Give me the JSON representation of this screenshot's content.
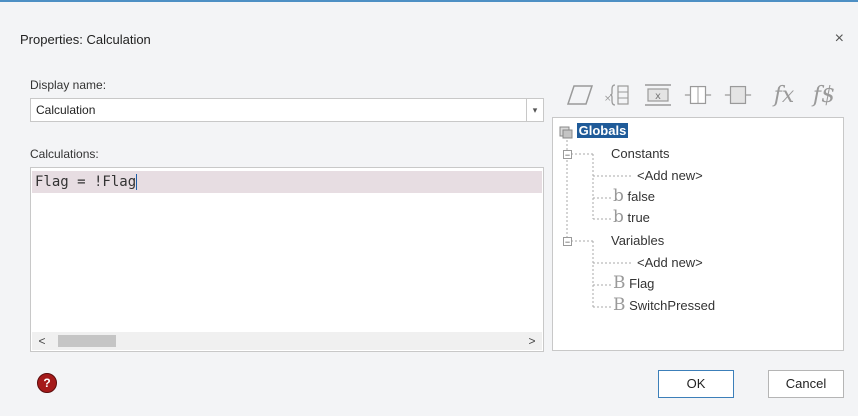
{
  "dialog": {
    "title": "Properties: Calculation",
    "close_glyph": "×"
  },
  "display_name": {
    "label": "Display name:",
    "value": "Calculation",
    "dropdown_glyph": "▾"
  },
  "calculations": {
    "label": "Calculations:",
    "code_line": "Flag = !Flag",
    "scroll_left_glyph": "<",
    "scroll_right_glyph": ">"
  },
  "toolbar": {
    "icons": [
      "parallelogram-icon",
      "x-brace-icon",
      "x-block-icon",
      "column-icon",
      "column-alt-icon",
      "fx-icon",
      "fs-icon"
    ],
    "fx_text": "fx",
    "fs_text": "f$"
  },
  "tree": {
    "root": "Globals",
    "constants": {
      "label": "Constants",
      "items": [
        "<Add new>",
        "false",
        "true"
      ]
    },
    "variables": {
      "label": "Variables",
      "items": [
        "<Add new>",
        "Flag",
        "SwitchPressed"
      ]
    },
    "bool_glyph": "b",
    "bool_var_glyph": "B",
    "collapse_glyph": "−"
  },
  "buttons": {
    "help": "?",
    "ok": "OK",
    "cancel": "Cancel"
  },
  "colors": {
    "accent": "#1f5b99",
    "title_border": "#4d8fc4",
    "code_highlight": "#e7dde2",
    "help_button": "#a51a1a"
  }
}
